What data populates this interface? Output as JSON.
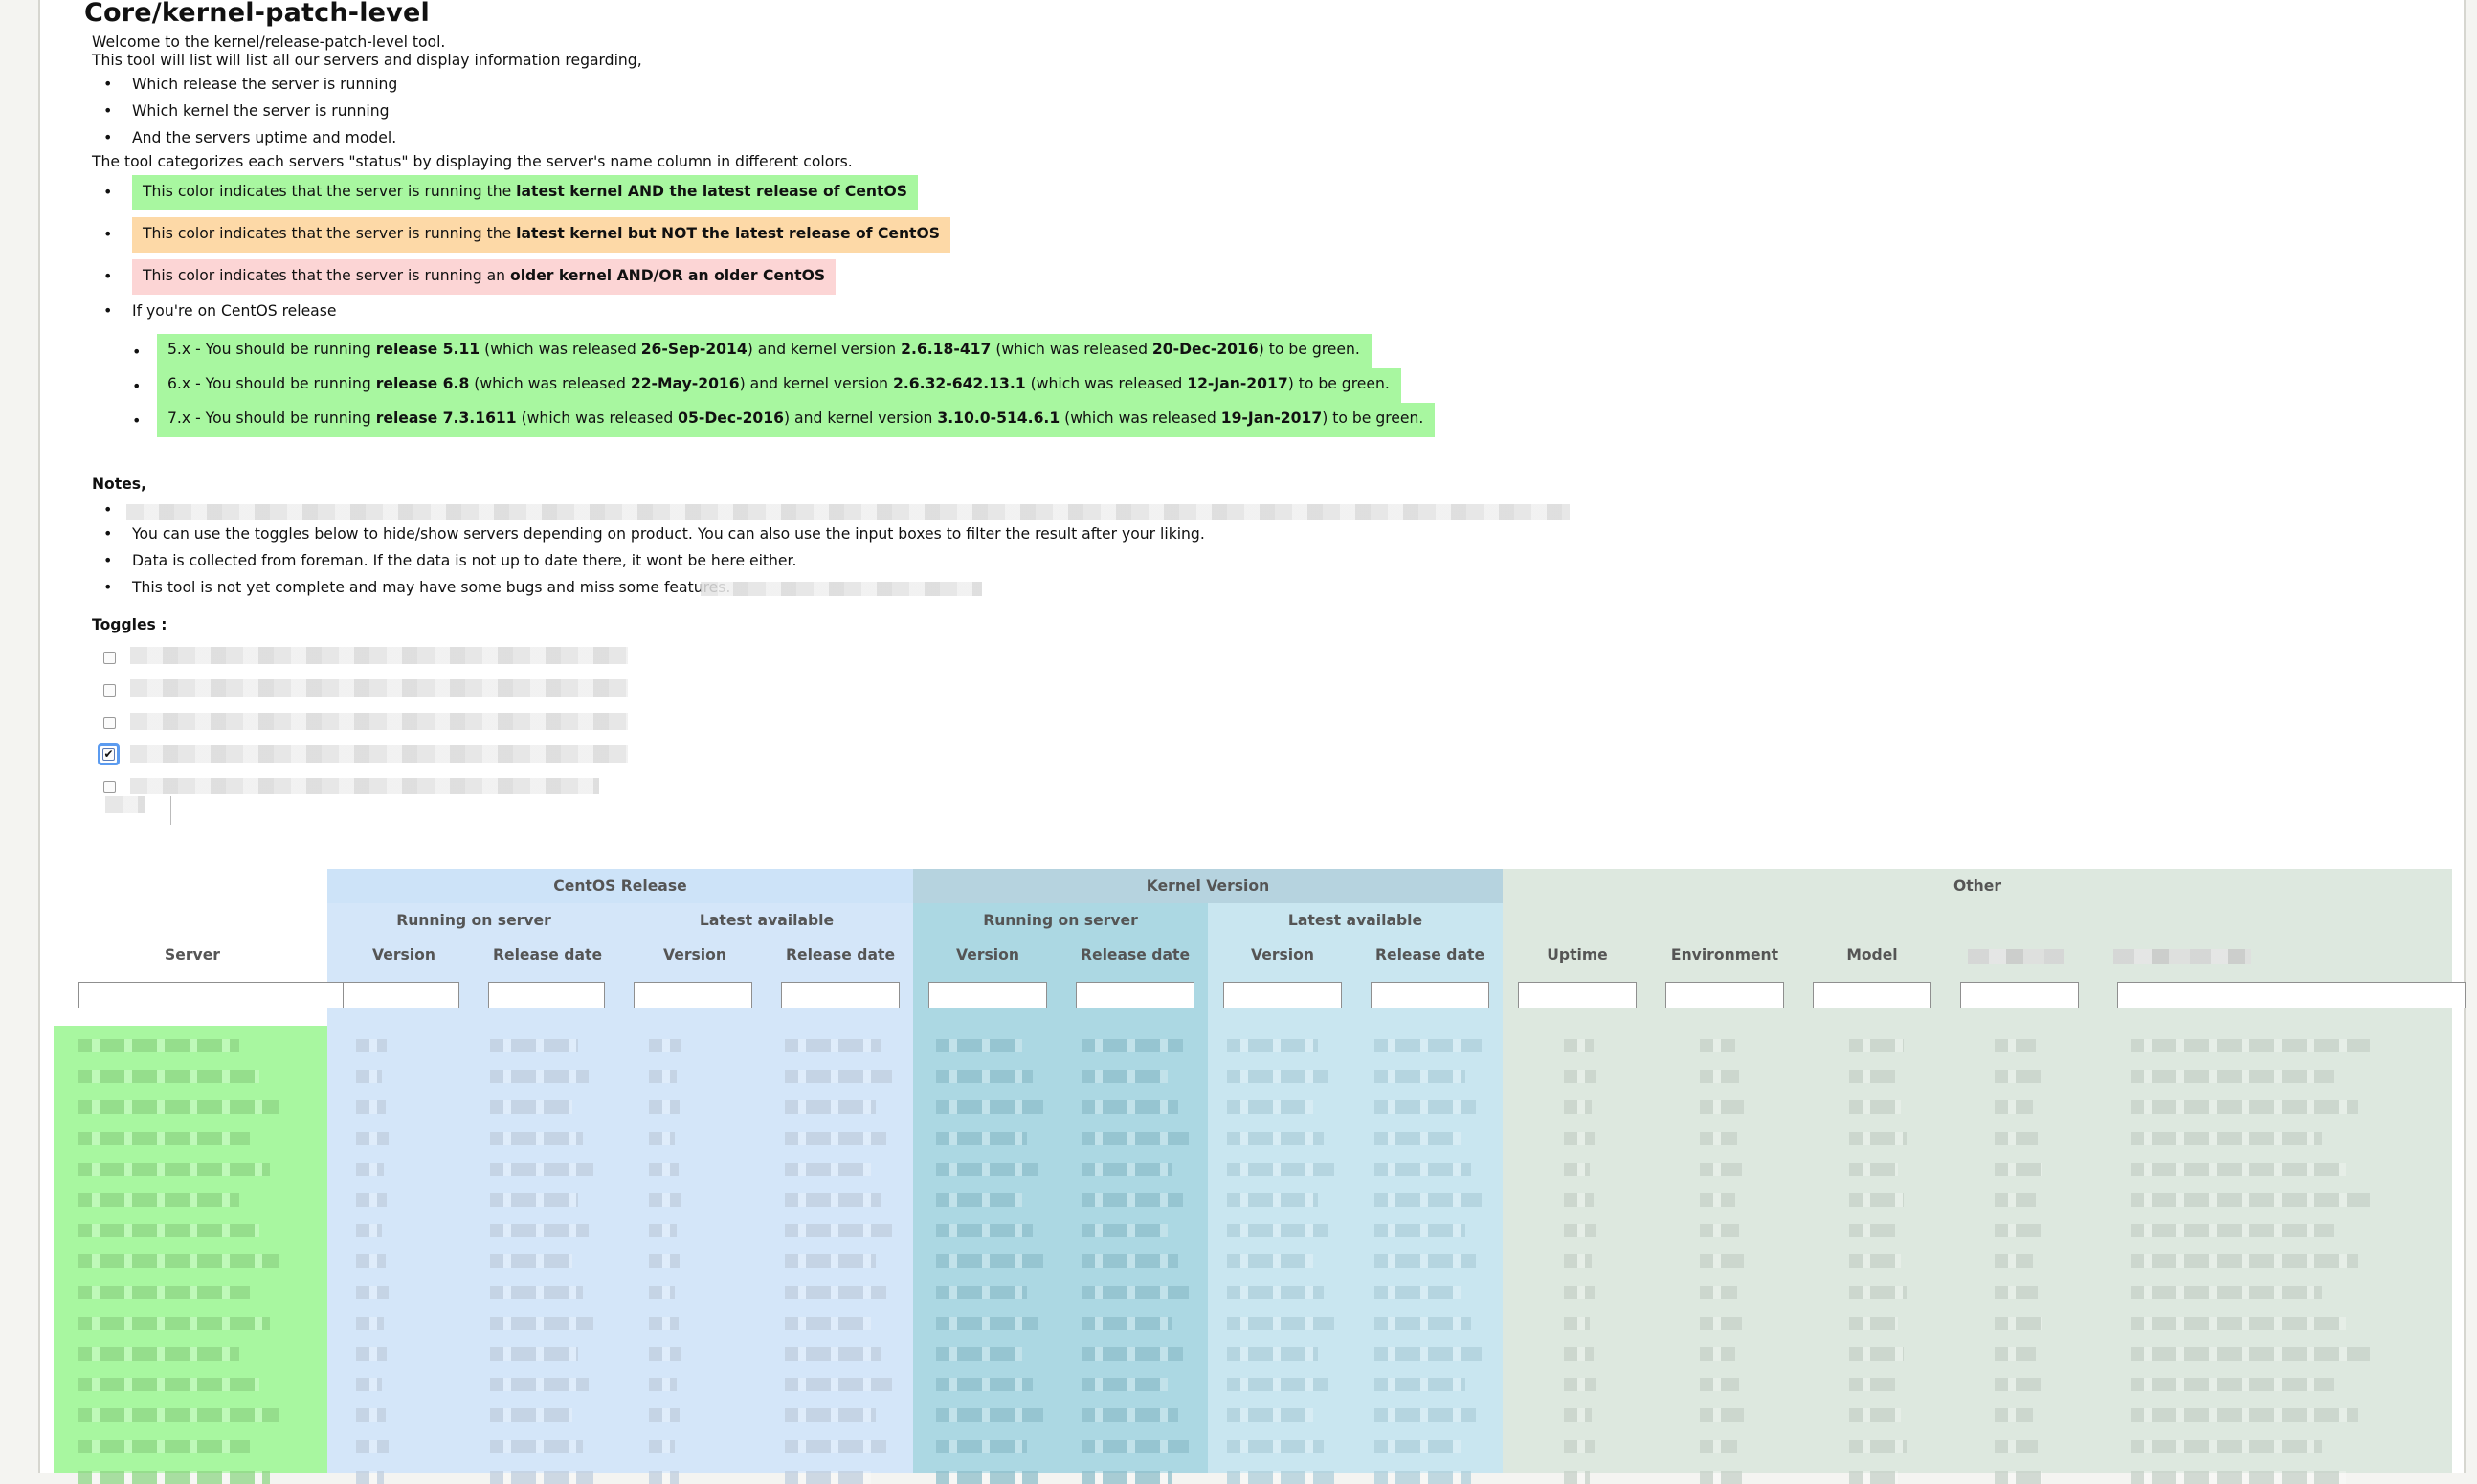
{
  "page": {
    "title": "Core/kernel-patch-level",
    "intro": [
      "Welcome to the kernel/release-patch-level tool.",
      "This tool will list will list all our servers and display information regarding,"
    ],
    "info_items": [
      "Which release the server is running",
      "Which kernel the server is running",
      "And the servers uptime and model."
    ],
    "categorize_text": "The tool categorizes each servers \"status\" by displaying the server's name column in different colors.",
    "legend": {
      "green": {
        "prefix": "This color indicates that the server is running the ",
        "bold": "latest kernel AND the latest release of CentOS",
        "color": "#a8f7a0"
      },
      "orange": {
        "prefix": "This color indicates that the server is running the ",
        "bold": "latest kernel but NOT the latest release of CentOS",
        "color": "#fdd9a7"
      },
      "pink": {
        "prefix": "This color indicates that the server is running an ",
        "bold": "older kernel AND/OR an older CentOS",
        "color": "#fcd5d5"
      }
    },
    "centos_intro": "If you're on CentOS release",
    "releases": [
      {
        "p1": "5.x - You should be running ",
        "b1": "release 5.11",
        "p2": " (which was released ",
        "b2": "26-Sep-2014",
        "p3": ") and kernel version ",
        "b3": "2.6.18-417",
        "p4": " (which was released ",
        "b4": "20-Dec-2016",
        "p5": ") to be green."
      },
      {
        "p1": "6.x - You should be running ",
        "b1": "release 6.8",
        "p2": " (which was released ",
        "b2": "22-May-2016",
        "p3": ") and kernel version ",
        "b3": "2.6.32-642.13.1",
        "p4": " (which was released ",
        "b4": "12-Jan-2017",
        "p5": ") to be green."
      },
      {
        "p1": "7.x - You should be running ",
        "b1": "release 7.3.1611",
        "p2": " (which was released ",
        "b2": "05-Dec-2016",
        "p3": ") and kernel version ",
        "b3": "3.10.0-514.6.1",
        "p4": " (which was released ",
        "b4": "19-Jan-2017",
        "p5": ") to be green."
      }
    ],
    "notes_heading": "Notes,",
    "notes": [
      "You can use the toggles below to hide/show servers depending on product. You can also use the input boxes to filter the result after your liking.",
      "Data is collected from foreman. If the data is not up to date there, it wont be here either.",
      "This tool is not yet complete and may have some bugs and miss some features."
    ],
    "toggles_heading": "Toggles :",
    "toggles": [
      {
        "checked": false
      },
      {
        "checked": false
      },
      {
        "checked": false
      },
      {
        "checked": true
      },
      {
        "checked": false
      }
    ],
    "checkmark": "✔"
  },
  "table": {
    "groups": {
      "centos_release": "CentOS Release",
      "kernel_version": "Kernel Version",
      "other": "Other"
    },
    "subgroups": {
      "centos_running": "Running on server",
      "centos_latest": "Latest available",
      "kernel_running": "Running on server",
      "kernel_latest": "Latest available"
    },
    "columns": {
      "server": "Server",
      "centos_running_version": "Version",
      "centos_running_date": "Release date",
      "centos_latest_version": "Version",
      "centos_latest_date": "Release date",
      "kernel_running_version": "Version",
      "kernel_running_date": "Release date",
      "kernel_latest_version": "Version",
      "kernel_latest_date": "Release date",
      "uptime": "Uptime",
      "environment": "Environment",
      "model": "Model"
    },
    "colors": {
      "server_green": "#a8f7a0",
      "centos_bg": "#d4e6f9",
      "centos_header": "#cde3f8",
      "kernel_running_bg": "#acd8e3",
      "kernel_latest_bg": "#c9e6f0",
      "kernel_header": "#b6d3df",
      "other_bg": "#dde8df"
    }
  }
}
